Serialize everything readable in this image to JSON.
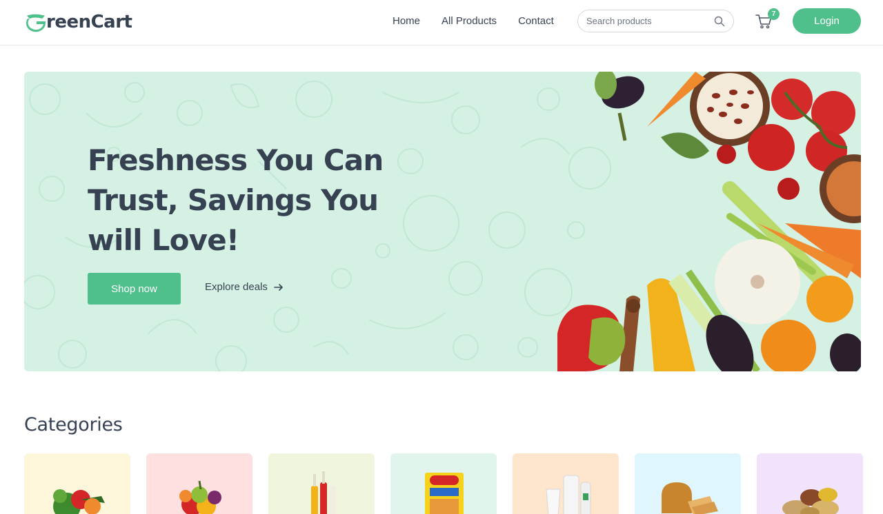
{
  "brand": {
    "name": "reenCart",
    "logo_icon": "leaf-g-icon",
    "accent": "#4fbf8b"
  },
  "nav": {
    "items": [
      {
        "label": "Home"
      },
      {
        "label": "All Products"
      },
      {
        "label": "Contact"
      }
    ]
  },
  "search": {
    "placeholder": "Search products",
    "icon": "search-icon"
  },
  "cart": {
    "count": "7",
    "icon": "cart-icon"
  },
  "login": {
    "label": "Login"
  },
  "hero": {
    "title": "Freshness You Can Trust, Savings You will Love!",
    "primary_cta": "Shop now",
    "secondary_cta": "Explore deals",
    "background": "#d4f1e4"
  },
  "categories": {
    "title": "Categories",
    "items": [
      {
        "name": "vegetables",
        "bg": "#fef6da"
      },
      {
        "name": "fruits",
        "bg": "#fee0e0"
      },
      {
        "name": "drinks",
        "bg": "#f0f5de"
      },
      {
        "name": "instant-food",
        "bg": "#e1f5ec"
      },
      {
        "name": "dairy",
        "bg": "#fee6cd"
      },
      {
        "name": "bakery",
        "bg": "#e0f6fe"
      },
      {
        "name": "grains",
        "bg": "#f1e3f9"
      }
    ]
  }
}
